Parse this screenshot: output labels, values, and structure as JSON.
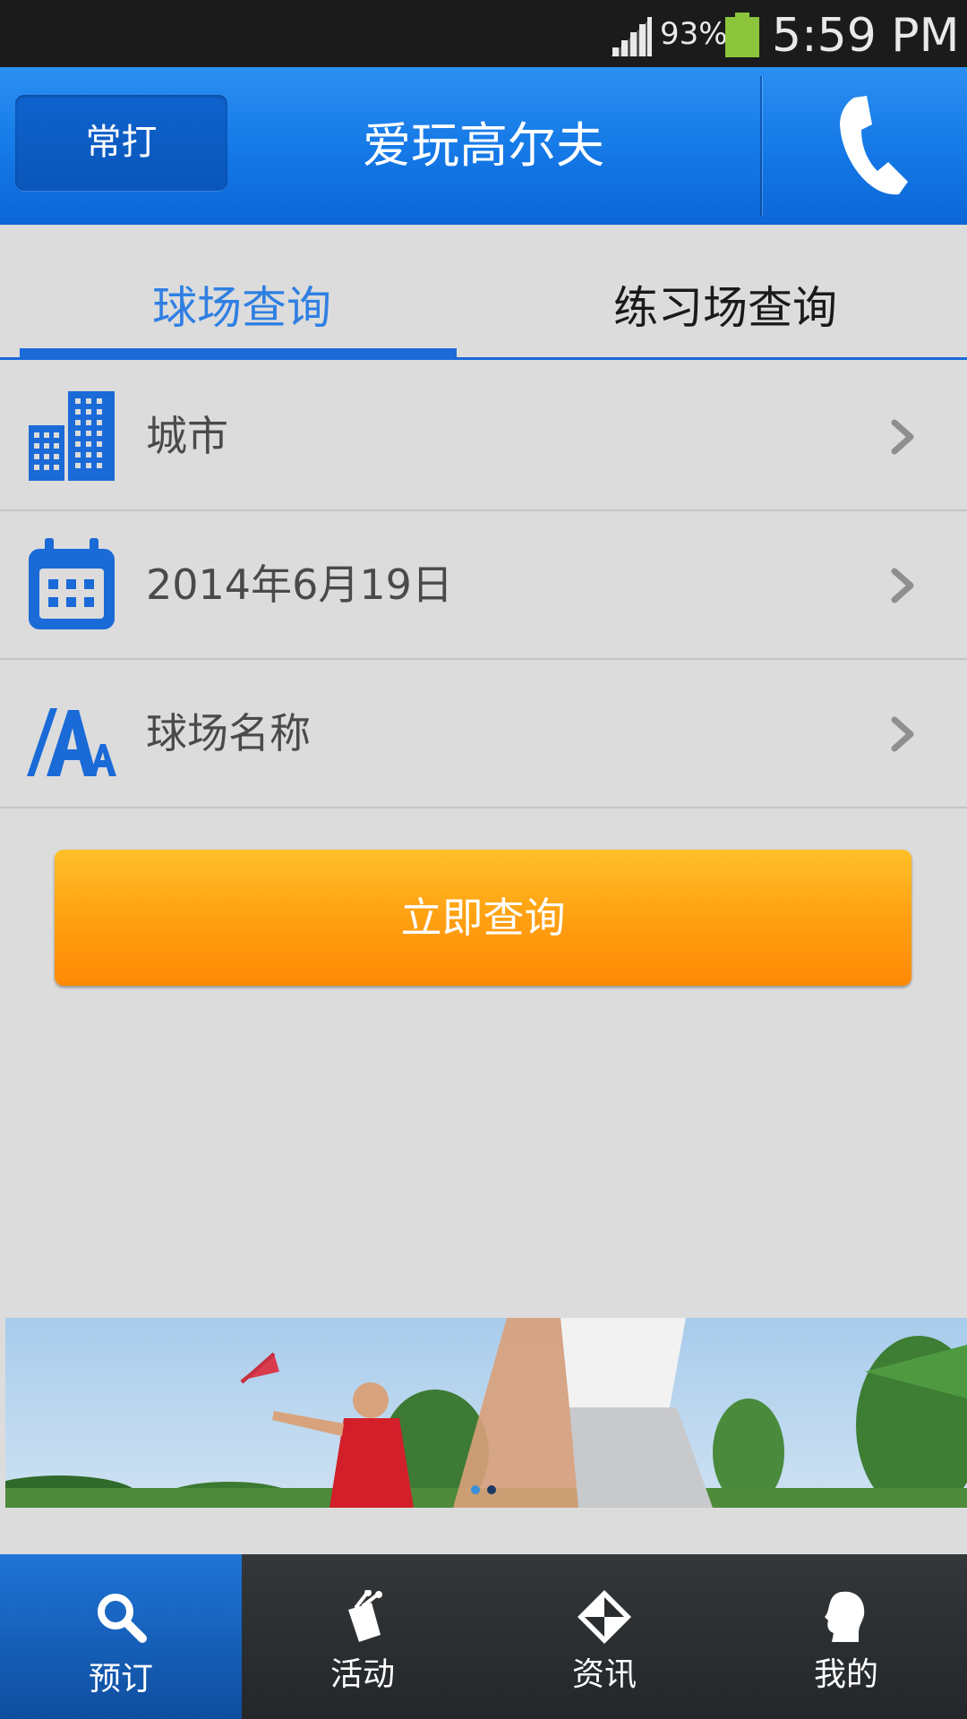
{
  "status_bar": {
    "battery_percent": "93%",
    "time": "5:59 PM",
    "signal_icon": "signal-icon",
    "battery_icon": "battery-icon"
  },
  "header": {
    "left_button": "常打",
    "title": "爱玩高尔夫",
    "phone_icon": "phone-icon"
  },
  "tabs": [
    {
      "label": "球场查询",
      "active": true
    },
    {
      "label": "练习场查询",
      "active": false
    }
  ],
  "form": {
    "rows": [
      {
        "icon": "city-buildings-icon",
        "label": "城市"
      },
      {
        "icon": "calendar-icon",
        "label": "2014年6月19日"
      },
      {
        "icon": "font-name-icon",
        "label": "球场名称"
      }
    ],
    "search_button": "立即查询"
  },
  "banner": {
    "image": "golf-players-photo",
    "pages": 2,
    "current_page": 1
  },
  "bottom_nav": [
    {
      "label": "预订",
      "icon": "search-icon",
      "active": true
    },
    {
      "label": "活动",
      "icon": "golf-bag-icon",
      "active": false
    },
    {
      "label": "资讯",
      "icon": "news-envelope-icon",
      "active": false
    },
    {
      "label": "我的",
      "icon": "user-head-icon",
      "active": false
    }
  ],
  "colors": {
    "brand_blue": "#1478e6",
    "active_tab": "#2f7fe3",
    "button_orange": "#ff9a0c",
    "nav_dark": "#2a2d30"
  }
}
